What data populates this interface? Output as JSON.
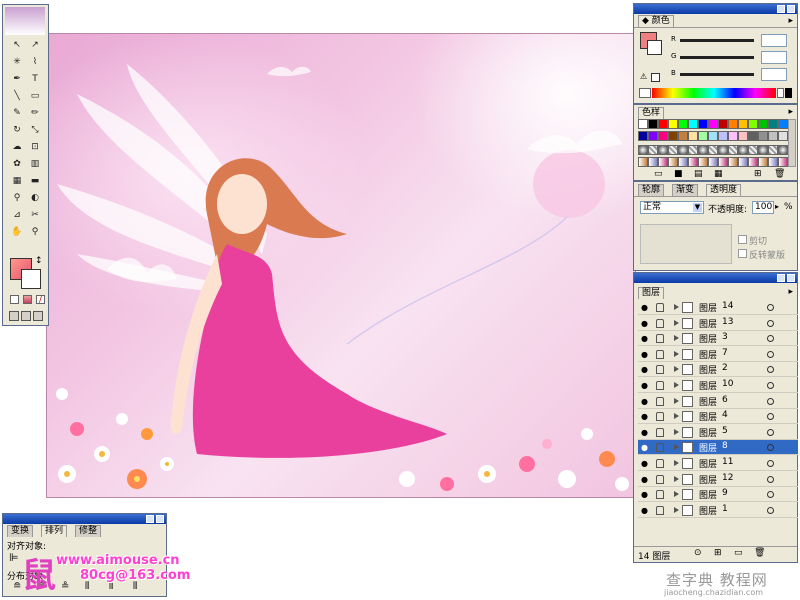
{
  "tools_panel": {
    "tool_icons": [
      "selection-icon",
      "direct-selection-icon",
      "magic-wand-icon",
      "lasso-icon",
      "pen-icon",
      "type-icon",
      "line-icon",
      "rectangle-icon",
      "paintbrush-icon",
      "pencil-icon",
      "rotate-icon",
      "scale-icon",
      "warp-icon",
      "free-transform-icon",
      "symbol-sprayer-icon",
      "column-graph-icon",
      "mesh-icon",
      "gradient-icon",
      "eyedropper-icon",
      "blend-icon",
      "slice-icon",
      "scissors-icon",
      "hand-icon",
      "zoom-icon"
    ]
  },
  "color_panel": {
    "title": "颜色",
    "channels": [
      "R",
      "G",
      "B"
    ],
    "fill_color": "#f08080",
    "stroke_color": "#ffffff"
  },
  "swatches_panel": {
    "title": "色样",
    "colors": [
      "#ffffff",
      "#000000",
      "#ff0000",
      "#ffff00",
      "#00ff00",
      "#00ffff",
      "#0000ff",
      "#ff00ff",
      "#c00000",
      "#ff8000",
      "#ffc000",
      "#80ff00",
      "#00c000",
      "#008080",
      "#0080ff",
      "#0000a0",
      "#8000ff",
      "#ff0080",
      "#804000",
      "#c08040",
      "#ffe0a0",
      "#a0ffa0",
      "#a0e0ff",
      "#c0c0ff",
      "#ffc0ff",
      "#ffc0c0",
      "#606060",
      "#909090",
      "#c0c0c0",
      "#e0e0e0"
    ]
  },
  "transparency_panel": {
    "tabs": [
      "轮廓",
      "渐变",
      "透明度"
    ],
    "active_tab": "透明度",
    "blend_mode": "正常",
    "opacity_label": "不透明度:",
    "opacity_value": "100",
    "opacity_unit": "%",
    "clip_label": "剪切",
    "invert_mask_label": "反转蒙版"
  },
  "layers_panel": {
    "title": "图层",
    "rows": [
      {
        "name": "图层",
        "num": "14",
        "selected": false
      },
      {
        "name": "图层",
        "num": "13",
        "selected": false
      },
      {
        "name": "图层",
        "num": "3",
        "selected": false
      },
      {
        "name": "图层",
        "num": "7",
        "selected": false
      },
      {
        "name": "图层",
        "num": "2",
        "selected": false
      },
      {
        "name": "图层",
        "num": "10",
        "selected": false
      },
      {
        "name": "图层",
        "num": "6",
        "selected": false
      },
      {
        "name": "图层",
        "num": "4",
        "selected": false
      },
      {
        "name": "图层",
        "num": "5",
        "selected": false
      },
      {
        "name": "图层",
        "num": "8",
        "selected": true
      },
      {
        "name": "图层",
        "num": "11",
        "selected": false
      },
      {
        "name": "图层",
        "num": "12",
        "selected": false
      },
      {
        "name": "图层",
        "num": "9",
        "selected": false
      },
      {
        "name": "图层",
        "num": "1",
        "selected": false
      }
    ],
    "footer_count": "14 图层"
  },
  "align_panel": {
    "tabs": [
      "变换",
      "排列",
      "修整"
    ],
    "active_tab": "排列",
    "align_objects_label": "对齐对象:",
    "distribute_label": "分布对象"
  },
  "watermark": {
    "line1": "www.aimouse.cn",
    "line2": "80cg@163.com",
    "site_logo": "查字典 教程网",
    "site_url": "jiaocheng.chazidian.com"
  }
}
